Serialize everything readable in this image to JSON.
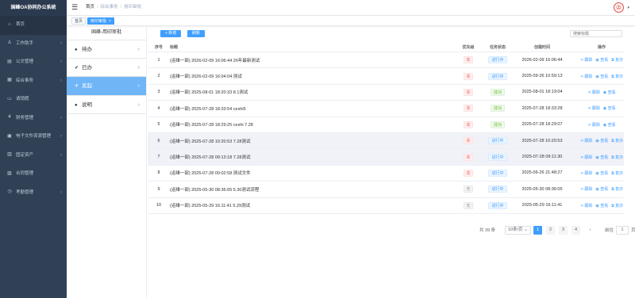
{
  "app_title": "国峰OA协同办公系统",
  "sidebar": {
    "items": [
      {
        "label": "首页",
        "icon": "home-icon",
        "glyph": "⌂",
        "arrow": false
      },
      {
        "label": "工作助手",
        "icon": "user-icon",
        "glyph": "♙",
        "arrow": true
      },
      {
        "label": "公文管理",
        "icon": "document-icon",
        "glyph": "▤",
        "arrow": true
      },
      {
        "label": "综合事务",
        "icon": "grid-icon",
        "glyph": "▦",
        "arrow": true
      },
      {
        "label": "请销假",
        "icon": "calendar-icon",
        "glyph": "▭",
        "arrow": false
      },
      {
        "label": "财务管理",
        "icon": "money-icon",
        "glyph": "¥",
        "arrow": true
      },
      {
        "label": "电子文件资源管理",
        "icon": "folder-icon",
        "glyph": "▣",
        "arrow": true
      },
      {
        "label": "固定资产",
        "icon": "asset-icon",
        "glyph": "▥",
        "arrow": true
      },
      {
        "label": "合同管理",
        "icon": "contract-icon",
        "glyph": "▧",
        "arrow": false
      },
      {
        "label": "考勤管理",
        "icon": "clock-icon",
        "glyph": "◷",
        "arrow": true
      }
    ]
  },
  "navbar": {
    "breadcrumb": [
      "首页",
      "综合事务",
      "用印审批"
    ]
  },
  "tags": {
    "home": "首页",
    "active": "用印审批"
  },
  "subpanel": {
    "title": "国峰-用印审批",
    "items": [
      {
        "label": "待办",
        "icon": "info-icon",
        "glyph": "●"
      },
      {
        "label": "已办",
        "icon": "check-icon",
        "glyph": "✔"
      },
      {
        "label": "发起",
        "icon": "send-icon",
        "glyph": "✈"
      },
      {
        "label": "说明",
        "icon": "location-icon",
        "glyph": "●"
      }
    ]
  },
  "toolbar": {
    "add_label": "+ 新增",
    "refresh_label": "刷新",
    "search_placeholder": "搜索标题"
  },
  "table": {
    "headers": {
      "idx": "序号",
      "title": "标题",
      "priority": "优先级",
      "status": "任务状态",
      "created": "创建时间",
      "ops": "操作"
    },
    "ops": {
      "track": "跟踪",
      "view": "查看",
      "copy": "复办"
    },
    "rows": [
      {
        "idx": "1",
        "title": "(运维一部) 2026-02-09 16:06:44 26年最新测试",
        "priority": "高",
        "pkind": "high",
        "status": "进行中",
        "skind": "run",
        "created": "2026-02-09 16:06:44",
        "copy": true
      },
      {
        "idx": "2",
        "title": "(运维一部) 2026-02-09 16:04:04 测试",
        "priority": "高",
        "pkind": "high",
        "status": "进行中",
        "skind": "run",
        "created": "2025-09-26 10:59:13",
        "copy": true
      },
      {
        "idx": "3",
        "title": "(运维一部) 2025-08-01 18:20:33 8.1测试",
        "priority": "高",
        "pkind": "high",
        "status": "成功",
        "skind": "ok",
        "created": "2025-08-01 18:19:04",
        "copy": false
      },
      {
        "idx": "4",
        "title": "(运维一部) 2025-07-28 18:33:54 ceshi5",
        "priority": "高",
        "pkind": "high",
        "status": "成功",
        "skind": "ok",
        "created": "2025-07-28 18:33:28",
        "copy": false
      },
      {
        "idx": "5",
        "title": "(运维一部) 2025-07-28 18:29:25 ceshi 7.28",
        "priority": "高",
        "pkind": "high",
        "status": "成功",
        "skind": "ok",
        "created": "2025-07-28 18:29:07",
        "copy": false
      },
      {
        "idx": "6",
        "title": "(运维一部) 2025-07-28 10:20:53 7.28测试",
        "priority": "高",
        "pkind": "high",
        "status": "进行中",
        "skind": "run",
        "created": "2025-07-28 10:20:53",
        "copy": true
      },
      {
        "idx": "7",
        "title": "(运维一部) 2025-07-28 09:13:18 7.28测试",
        "priority": "高",
        "pkind": "high",
        "status": "进行中",
        "skind": "run",
        "created": "2025-07-28 09:11:30",
        "copy": true
      },
      {
        "idx": "8",
        "title": "(运维一部) 2025-07-28 09:02:58 测试文件",
        "priority": "高",
        "pkind": "high",
        "status": "进行中",
        "skind": "run",
        "created": "2025-06-26 21:48:27",
        "copy": true
      },
      {
        "idx": "9",
        "title": "(运维一部) 2025-05-30 08:36:05 5.30测试流程",
        "priority": "无",
        "pkind": "none",
        "status": "进行中",
        "skind": "run",
        "created": "2025-05-30 08:36:05",
        "copy": true
      },
      {
        "idx": "10",
        "title": "(运维一部) 2025-05-29 16:11:41 5.29测试",
        "priority": "无",
        "pkind": "none",
        "status": "进行中",
        "skind": "run",
        "created": "2025-05-29 16:11:41",
        "copy": true
      }
    ]
  },
  "pager": {
    "total": "共 39 条",
    "size": "10条/页",
    "pages": [
      "1",
      "2",
      "3",
      "4"
    ],
    "current": "1",
    "goto": "前往",
    "goto_value": "1",
    "page_unit": "页"
  },
  "colors": {
    "accent": "#409eff",
    "sidebar": "#304156",
    "active_sub": "#70b6f7"
  }
}
